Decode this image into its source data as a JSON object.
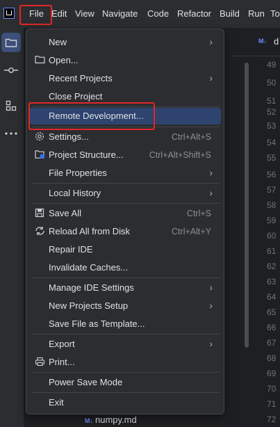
{
  "menubar": {
    "items": [
      "File",
      "Edit",
      "View",
      "Navigate",
      "Code",
      "Refactor",
      "Build",
      "Run",
      "To"
    ],
    "accent": "#e3262a"
  },
  "toolstrip": {
    "icons": [
      "project-folder-icon",
      "commit-icon",
      "structure-icon",
      "more-icon"
    ],
    "active_bg": "#3d4f7a"
  },
  "editor": {
    "tab_badge": "M↓",
    "tab_label": "d",
    "line_numbers": [
      "49",
      "50",
      "51",
      "52",
      "53",
      "54",
      "55",
      "56",
      "57",
      "58",
      "59",
      "60",
      "61",
      "62",
      "63",
      "64",
      "65",
      "66",
      "67",
      "68",
      "69",
      "70",
      "71",
      "72"
    ],
    "footer_badge": "M↓",
    "footer_file": "numpy.md"
  },
  "file_menu": {
    "items": [
      {
        "label": "New",
        "icon": "",
        "shortcut": "",
        "submenu": true
      },
      {
        "label": "Open...",
        "icon": "folder-icon",
        "shortcut": "",
        "submenu": false
      },
      {
        "label": "Recent Projects",
        "icon": "",
        "shortcut": "",
        "submenu": true
      },
      {
        "label": "Close Project",
        "icon": "",
        "shortcut": "",
        "submenu": false
      },
      {
        "label": "Remote Development...",
        "icon": "",
        "shortcut": "",
        "submenu": false,
        "selected": true
      },
      {
        "label": "Settings...",
        "icon": "gear-icon",
        "shortcut": "Ctrl+Alt+S",
        "submenu": false
      },
      {
        "label": "Project Structure...",
        "icon": "project-structure-icon",
        "shortcut": "Ctrl+Alt+Shift+S",
        "submenu": false
      },
      {
        "label": "File Properties",
        "icon": "",
        "shortcut": "",
        "submenu": true
      },
      {
        "label": "Local History",
        "icon": "",
        "shortcut": "",
        "submenu": true
      },
      {
        "label": "Save All",
        "icon": "save-icon",
        "shortcut": "Ctrl+S",
        "submenu": false
      },
      {
        "label": "Reload All from Disk",
        "icon": "reload-icon",
        "shortcut": "Ctrl+Alt+Y",
        "submenu": false
      },
      {
        "label": "Repair IDE",
        "icon": "",
        "shortcut": "",
        "submenu": false
      },
      {
        "label": "Invalidate Caches...",
        "icon": "",
        "shortcut": "",
        "submenu": false
      },
      {
        "label": "Manage IDE Settings",
        "icon": "",
        "shortcut": "",
        "submenu": true
      },
      {
        "label": "New Projects Setup",
        "icon": "",
        "shortcut": "",
        "submenu": true
      },
      {
        "label": "Save File as Template...",
        "icon": "",
        "shortcut": "",
        "submenu": false
      },
      {
        "label": "Export",
        "icon": "",
        "shortcut": "",
        "submenu": true
      },
      {
        "label": "Print...",
        "icon": "print-icon",
        "shortcut": "",
        "submenu": false
      },
      {
        "label": "Power Save Mode",
        "icon": "",
        "shortcut": "",
        "submenu": false
      },
      {
        "label": "Exit",
        "icon": "",
        "shortcut": "",
        "submenu": false
      }
    ]
  }
}
